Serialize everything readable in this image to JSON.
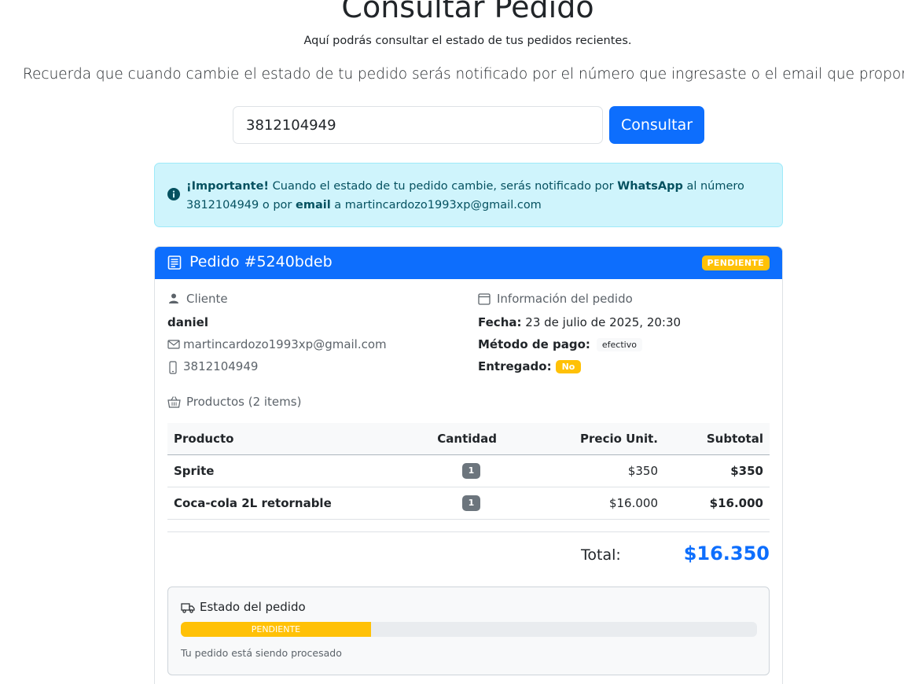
{
  "header": {
    "title": "Consultar Pedido",
    "subtitle": "Aquí podrás consultar el estado de tus pedidos recientes.",
    "lead": "Recuerda que cuando cambie el estado de tu pedido serás notificado por el número que ingresaste o el email que proporcionast"
  },
  "search": {
    "value": "3812104949",
    "button_label": "Consultar"
  },
  "alert": {
    "icon": "info-circle-icon",
    "strong_label": "¡Importante!",
    "text_1": " Cuando el estado de tu pedido cambie, serás notificado por ",
    "channel_whatsapp": "WhatsApp",
    "text_2": " al número 3812104949 o por ",
    "channel_email": "email",
    "text_3": " a martincardozo1993xp@gmail.com"
  },
  "order": {
    "title": "Pedido #5240bdeb",
    "status_badge": "PENDIENTE",
    "customer_section": {
      "label": "Cliente",
      "name": "daniel",
      "email": "martincardozo1993xp@gmail.com",
      "phone": "3812104949"
    },
    "info_section": {
      "label": "Información del pedido",
      "date_label": "Fecha:",
      "date_value": " 23 de julio de 2025, 20:30",
      "payment_label": "Método de pago:",
      "payment_value": "efectivo",
      "delivered_label": "Entregado:",
      "delivered_value": "No"
    },
    "products": {
      "label": "Productos (2 items)",
      "columns": [
        "Producto",
        "Cantidad",
        "Precio Unit.",
        "Subtotal"
      ],
      "rows": [
        {
          "name": "Sprite",
          "qty": "1",
          "unit_price": "$350",
          "subtotal": "$350"
        },
        {
          "name": "Coca-cola 2L retornable",
          "qty": "1",
          "unit_price": "$16.000",
          "subtotal": "$16.000"
        }
      ]
    },
    "total_label": "Total:",
    "total_value": "$16.350",
    "status_box": {
      "title": "Estado del pedido",
      "progress_label": "PENDIENTE",
      "progress_percent": 33,
      "message": "Tu pedido está siendo procesado"
    }
  },
  "colors": {
    "primary": "#0d6efd",
    "warning": "#ffc107",
    "info_bg": "#cff4fc",
    "info_text": "#055160"
  }
}
